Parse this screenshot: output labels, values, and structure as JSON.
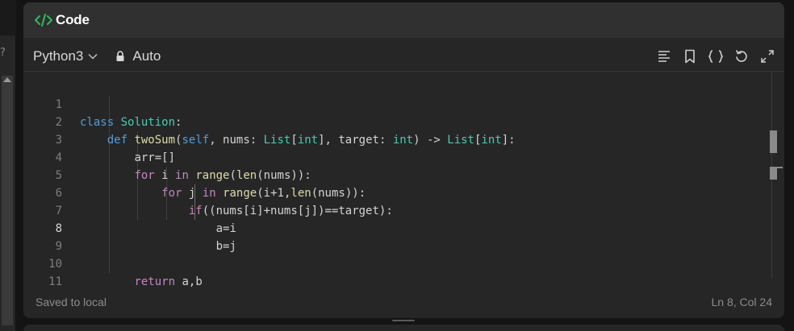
{
  "panel": {
    "title": "Code",
    "icon": "code-brackets-icon",
    "accent": "#2cbb5d"
  },
  "toolbar": {
    "language": "Python3",
    "mode": "Auto",
    "icons": [
      "format-icon",
      "bookmark-icon",
      "braces-icon",
      "reset-icon",
      "expand-icon"
    ]
  },
  "editor": {
    "active_line": 8,
    "lines": [
      {
        "n": "1",
        "text": "class Solution:"
      },
      {
        "n": "2",
        "text": "    def twoSum(self, nums: List[int], target: int) -> List[int]:"
      },
      {
        "n": "3",
        "text": "        arr=[]"
      },
      {
        "n": "4",
        "text": "        for i in range(len(nums)):"
      },
      {
        "n": "5",
        "text": "            for j in range(i+1,len(nums)):"
      },
      {
        "n": "6",
        "text": "                if((nums[i]+nums[j])==target):"
      },
      {
        "n": "7",
        "text": "                    a=i"
      },
      {
        "n": "8",
        "text": "                    b=j"
      },
      {
        "n": "9",
        "text": ""
      },
      {
        "n": "10",
        "text": "        return a,b"
      },
      {
        "n": "11",
        "text": ""
      }
    ]
  },
  "status": {
    "left": "Saved to local",
    "right": "Ln 8, Col 24"
  },
  "sidebar": {
    "glyph": "?"
  }
}
